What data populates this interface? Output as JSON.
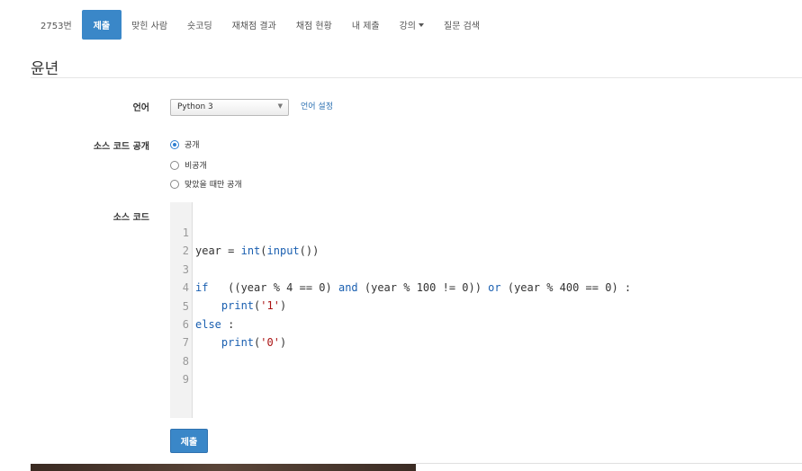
{
  "nav": {
    "tabs": [
      {
        "label": "2753번",
        "active": false
      },
      {
        "label": "제출",
        "active": true
      },
      {
        "label": "맞힌 사람",
        "active": false
      },
      {
        "label": "숏코딩",
        "active": false
      },
      {
        "label": "재채점 결과",
        "active": false
      },
      {
        "label": "채점 현황",
        "active": false
      },
      {
        "label": "내 제출",
        "active": false
      },
      {
        "label": "강의",
        "active": false,
        "dropdown": true
      },
      {
        "label": "질문 검색",
        "active": false
      }
    ]
  },
  "page": {
    "title": "윤년"
  },
  "form": {
    "language_label": "언어",
    "language_value": "Python 3",
    "language_settings_link": "언어 설정",
    "visibility_label": "소스 코드 공개",
    "visibility_options": [
      {
        "label": "공개",
        "checked": true
      },
      {
        "label": "비공개",
        "checked": false
      },
      {
        "label": "맞았을 때만 공개",
        "checked": false
      }
    ],
    "source_label": "소스 코드",
    "submit_label": "제출"
  },
  "editor": {
    "lines": [
      "year = int(input())",
      "",
      "if   ((year % 4 == 0) and (year % 100 != 0)) or (year % 400 == 0) :",
      "    print('1')",
      "else :",
      "    print('0')",
      "",
      "",
      ""
    ]
  },
  "colors": {
    "accent": "#3a87c8",
    "link": "#2a6fb1",
    "keyword": "#1a5fb0",
    "string": "#aa1111"
  }
}
